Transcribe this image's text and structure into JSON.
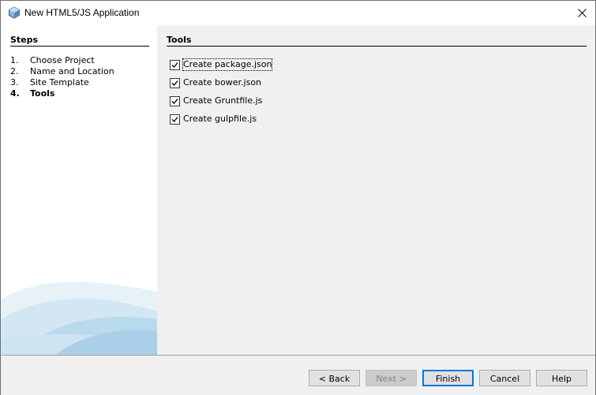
{
  "window": {
    "title": "New HTML5/JS Application"
  },
  "steps": {
    "header": "Steps",
    "items": [
      {
        "num": "1.",
        "label": "Choose Project"
      },
      {
        "num": "2.",
        "label": "Name and Location"
      },
      {
        "num": "3.",
        "label": "Site Template"
      },
      {
        "num": "4.",
        "label": "Tools"
      }
    ]
  },
  "tools": {
    "header": "Tools",
    "options": [
      {
        "label": "Create package.json",
        "checked": true
      },
      {
        "label": "Create bower.json",
        "checked": true
      },
      {
        "label": "Create Gruntfile.js",
        "checked": true
      },
      {
        "label": "Create gulpfile.js",
        "checked": true
      }
    ]
  },
  "buttons": {
    "back": "< Back",
    "next": "Next >",
    "finish": "Finish",
    "cancel": "Cancel",
    "help": "Help"
  },
  "icons": {
    "app": "netbeans-cube-icon",
    "close": "close-icon"
  }
}
